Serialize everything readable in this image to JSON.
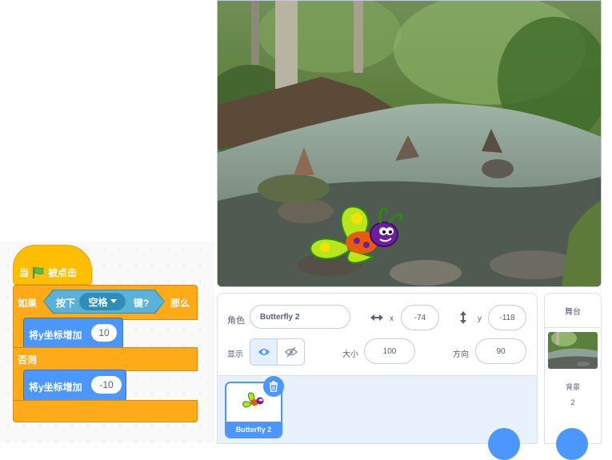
{
  "blocks": {
    "hat_when": "当",
    "hat_clicked": "被点击",
    "if_label": "如果",
    "sensing_key_prefix": "按下",
    "key_option": "空格",
    "sensing_key_suffix": "键?",
    "then_label": "那么",
    "change_y_1_label": "将y坐标增加",
    "change_y_1_value": "10",
    "else_label": "否则",
    "change_y_2_label": "将y坐标增加",
    "change_y_2_value": "-10"
  },
  "sprite_info": {
    "sprite_label": "角色",
    "sprite_name": "Butterfly 2",
    "x_label": "x",
    "x_value": "-74",
    "y_label": "y",
    "y_value": "-118",
    "show_label": "显示",
    "size_label": "大小",
    "size_value": "100",
    "direction_label": "方向",
    "direction_value": "90"
  },
  "sprite_list": [
    {
      "name": "Butterfly 2",
      "selected": true
    }
  ],
  "stage_selector": {
    "title": "舞台",
    "backdrops_label": "背景",
    "backdrop_count": "2"
  },
  "icons": [
    "green-flag-icon",
    "dropdown-arrow-icon",
    "x-arrows-icon",
    "y-arrows-icon",
    "eye-icon",
    "eye-slash-icon",
    "trash-icon"
  ],
  "colors": {
    "events": "#ffbf00",
    "control": "#ffab19",
    "motion": "#4c97ff",
    "sensing": "#5cb1d6",
    "accent": "#4c97ff"
  }
}
